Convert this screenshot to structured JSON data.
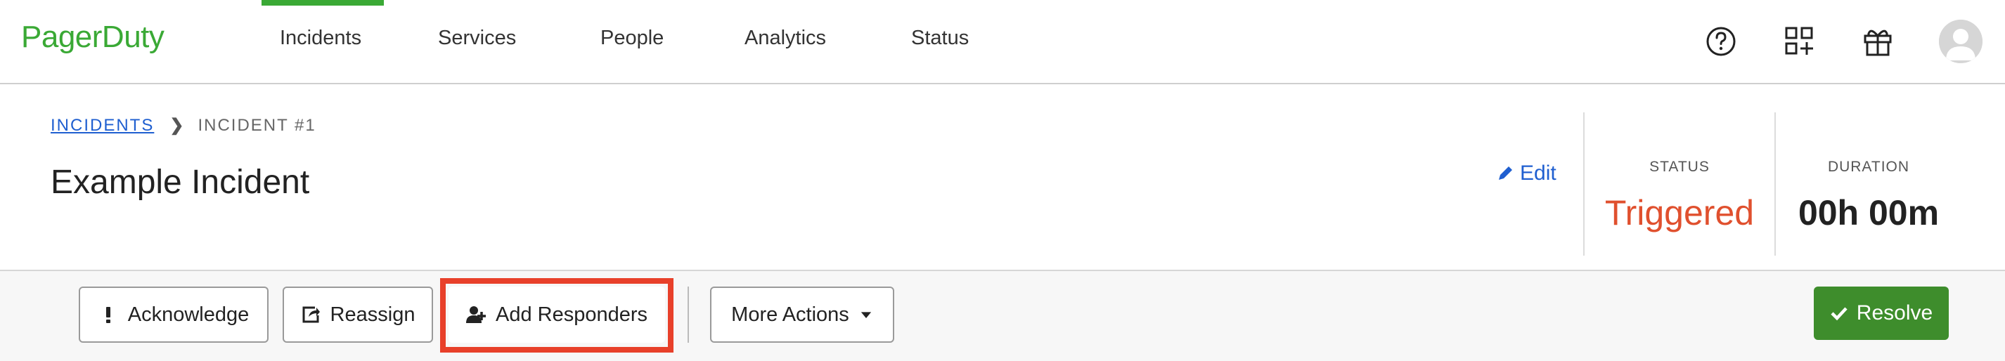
{
  "brand": "PagerDuty",
  "nav": {
    "items": [
      {
        "label": "Incidents",
        "active": true
      },
      {
        "label": "Services"
      },
      {
        "label": "People"
      },
      {
        "label": "Analytics"
      },
      {
        "label": "Status"
      }
    ],
    "icons": [
      "help-icon",
      "apps-icon",
      "gift-icon",
      "avatar-icon"
    ]
  },
  "breadcrumb": {
    "parent": "INCIDENTS",
    "current": "INCIDENT #1"
  },
  "incident": {
    "title": "Example Incident",
    "edit_label": "Edit",
    "status_label": "STATUS",
    "status_value": "Triggered",
    "duration_label": "DURATION",
    "duration_value": "00h 00m"
  },
  "actions": {
    "acknowledge": "Acknowledge",
    "reassign": "Reassign",
    "add_responders": "Add Responders",
    "more_actions": "More Actions",
    "resolve": "Resolve"
  },
  "colors": {
    "brand_green": "#3aa935",
    "status_triggered": "#e0502e",
    "resolve_green": "#3e8d2c",
    "link_blue": "#1f5fd0",
    "highlight_red": "#e8402a"
  }
}
